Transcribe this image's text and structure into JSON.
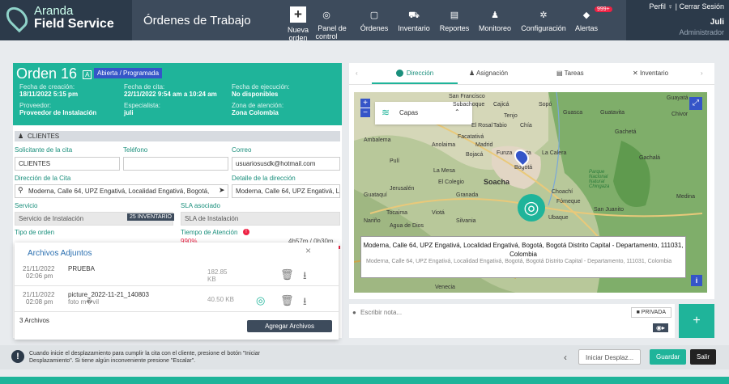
{
  "brand": {
    "line1": "Aranda",
    "line2": "Field Service"
  },
  "page_title": "Órdenes de Trabajo",
  "nav": [
    "Nueva orden",
    "Panel de control",
    "Órdenes",
    "Inventario",
    "Reportes",
    "Monitoreo",
    "Configuración",
    "Alertas"
  ],
  "alerts_badge": "999+",
  "user": {
    "profile": "Perfil",
    "logout": "Cerrar Sesión",
    "name": "Juli",
    "role": "Administrador"
  },
  "order": {
    "title": "Orden",
    "number": "16",
    "type_letter": "A",
    "status": "Abierta / Programada",
    "fields": [
      {
        "label": "Fecha de creación:",
        "value": "18/11/2022 5:15 pm"
      },
      {
        "label": "Fecha de cita:",
        "value": "22/11/2022 9:54 am a 10:24 am"
      },
      {
        "label": "Fecha de ejecución:",
        "value": "No disponibles"
      },
      {
        "label": "Proveedor:",
        "value": "Proveedor de Instalación"
      },
      {
        "label": "Especialista:",
        "value": "juli"
      },
      {
        "label": "Zona de atención:",
        "value": "Zona Colombia"
      }
    ]
  },
  "client_section": "CLIENTES",
  "form": {
    "solicitante_label": "Solicitante de la cita",
    "solicitante": "CLIENTES",
    "telefono_label": "Teléfono",
    "telefono": "",
    "correo_label": "Correo",
    "correo": "usuariosusdk@hotmail.com",
    "direccion_label": "Dirección de la Cita",
    "direccion": "Moderna, Calle 64, UPZ Engativá, Localidad Engativá, Bogotá,",
    "detalle_label": "Detalle de la dirección",
    "detalle": "Moderna, Calle 64, UPZ Engativá, L",
    "servicio_label": "Servicio",
    "servicio": "Servicio de Instalación",
    "servicio_tag": "25 INVENTARIO",
    "sla_label": "SLA asociado",
    "sla": "SLA de Instalación",
    "tipo_label": "Tipo de orden",
    "tiempo_label": "Tiempo de Atención",
    "tiempo_pct": "990%",
    "tiempo_val": "4h57m / 0h30m"
  },
  "attachments": {
    "title": "Archivos Adjuntos",
    "count": "3 Archivos",
    "add": "Agregar Archivos",
    "rows": [
      {
        "date": "21/11/2022",
        "time": "02:06 pm",
        "name": "PRUEBA",
        "sub": "",
        "size": "182.85",
        "unit": "KB"
      },
      {
        "date": "21/11/2022",
        "time": "02:08 pm",
        "name": "picture_2022-11-21_140803",
        "sub": "foto m�vil",
        "size": "40.50 KB",
        "unit": ""
      }
    ]
  },
  "tabs": [
    "Dirección",
    "Asignación",
    "Tareas",
    "Inventario"
  ],
  "map": {
    "layers": "Capas",
    "places": [
      "San Francisco",
      "Subachoque",
      "Cajicá",
      "Sopó",
      "Guasca",
      "Guatavita",
      "Tenjo",
      "Chía",
      "Guayatá",
      "El Rosal",
      "Tabio",
      "Facatativá",
      "Madrid",
      "Funza",
      "Cota",
      "La Calera",
      "Bojacá",
      "Pulí",
      "Anolaima",
      "Ambalema",
      "La Mesa",
      "Bogotá",
      "El Colegio",
      "Soacha",
      "Jerusalén",
      "Guataquí",
      "Granada",
      "Choachí",
      "Fómeque",
      "Tocaima",
      "Viotá",
      "Silvania",
      "Nariño",
      "Agua de Dios",
      "Ubaque",
      "San Juanito",
      "Medina",
      "Gachetá",
      "Gachalá",
      "Chivor",
      "Parque Nacional Natural Chingaza",
      "Venecia"
    ],
    "address_main": "Moderna, Calle 64, UPZ Engativá, Localidad Engativá, Bogotá, Bogotá Distrito Capital - Departamento, 111031, Colombia",
    "address_sub": "Moderna, Calle 64, UPZ Engativá, Localidad Engativá, Bogotá, Bogotá Distrito Capital - Departamento, 111031, Colombia"
  },
  "note": {
    "placeholder": "Escribir nota...",
    "private": "PRIVADA"
  },
  "bottom": {
    "message": "Cuando inicie el desplazamiento para cumplir la cita con el cliente, presione el botón \"Iniciar Desplazamiento\". Si tiene algún inconveniente presione \"Escalar\".",
    "start": "Iniciar Desplaz...",
    "save": "Guardar",
    "exit": "Salir"
  },
  "colors": {
    "accent": "#1fb49a",
    "header": "#2c3a4a",
    "status": "#3555c8",
    "alert": "#e24444"
  }
}
